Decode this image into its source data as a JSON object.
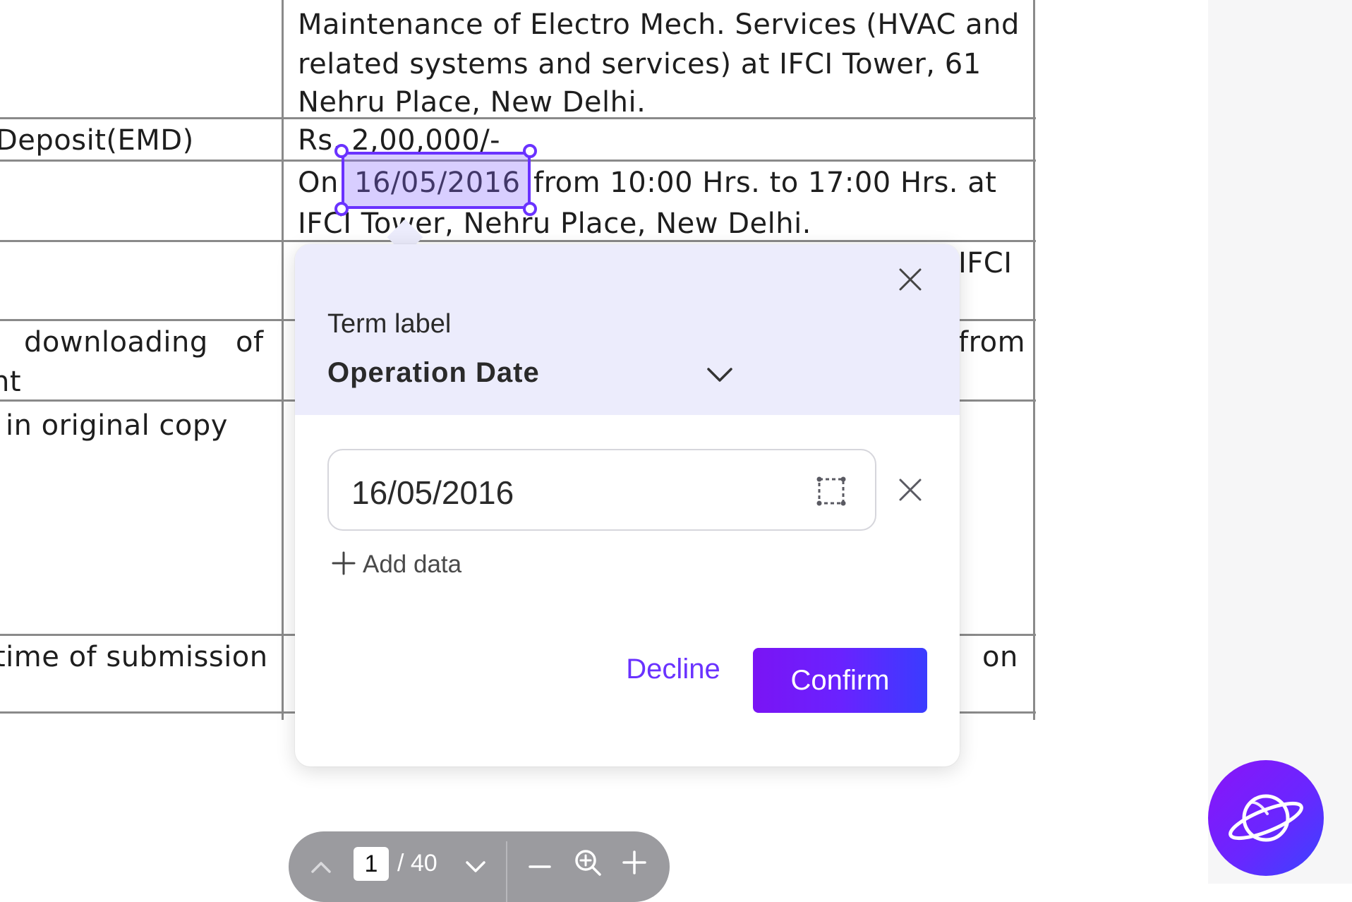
{
  "document": {
    "lines": [
      "Maintenance of Electro Mech. Services (HVAC and",
      "related systems and services) at IFCI Tower, 61",
      "Nehru Place, New Delhi.",
      "Deposit(EMD)",
      "Rs. 2,00,000/-",
      "On",
      "from 10:00 Hrs. to 17:00 Hrs. at",
      "IFCI Tower, Nehru Place, New Delhi.",
      "IFCI",
      "downloading",
      "of",
      "from",
      "nt",
      "in original copy",
      "time of submission",
      "on"
    ],
    "highlighted_text": "16/05/2016"
  },
  "term_popover": {
    "caption": "Term label",
    "selected_term": "Operation Date",
    "value": "16/05/2016",
    "add_data_label": "Add data",
    "decline_label": "Decline",
    "confirm_label": "Confirm",
    "icons": [
      "close-icon",
      "chevron-down-icon",
      "area-select-icon",
      "clear-icon",
      "plus-icon"
    ]
  },
  "pager": {
    "current_page": "1",
    "total_pages": "/ 40",
    "icons": [
      "chevron-up-icon",
      "chevron-down-icon",
      "zoom-out-icon",
      "zoom-icon",
      "zoom-in-icon"
    ]
  },
  "assistant": {
    "icon": "planet-icon"
  },
  "colors": {
    "accent": "#6a32ff",
    "popover_header": "#ececfc",
    "toolbar": "#9b9b9f",
    "fab_start": "#8a14f8",
    "fab_end": "#3a44ff"
  }
}
